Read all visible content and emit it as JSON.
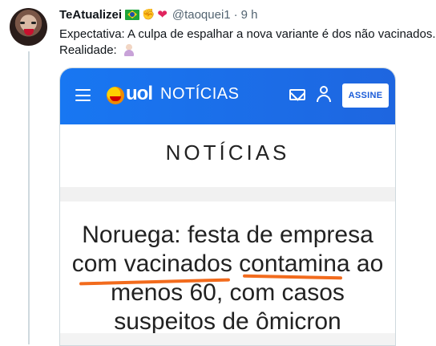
{
  "tweet": {
    "display_name": "TeAtualizei",
    "badges": [
      "brazil-flag-emoji",
      "fist-bump-emoji",
      "red-heart-emoji"
    ],
    "handle": "@taoquei1",
    "separator": "·",
    "time": "9 h",
    "text_line_1": "Expectativa: A culpa de espalhar a nova variante é dos não vacinados.",
    "text_line_2": "Realidade: ",
    "text_emoji": "woman-shrugging-emoji"
  },
  "media": {
    "nav": {
      "brand": "uol",
      "section": "NOTÍCIAS",
      "subscribe_label": "ASSINE",
      "icons": [
        "menu-icon",
        "uol-logo-icon",
        "mail-icon",
        "user-icon"
      ]
    },
    "section_title": "NOTÍCIAS",
    "headline": {
      "line_1": "Noruega: festa de empresa",
      "line_2": "com vacinados contamina ao",
      "line_3": "menos 60, com casos",
      "line_4": "suspeitos de ômicron"
    },
    "annotation_color": "#f26b1d",
    "nav_color": "#1877f2"
  }
}
